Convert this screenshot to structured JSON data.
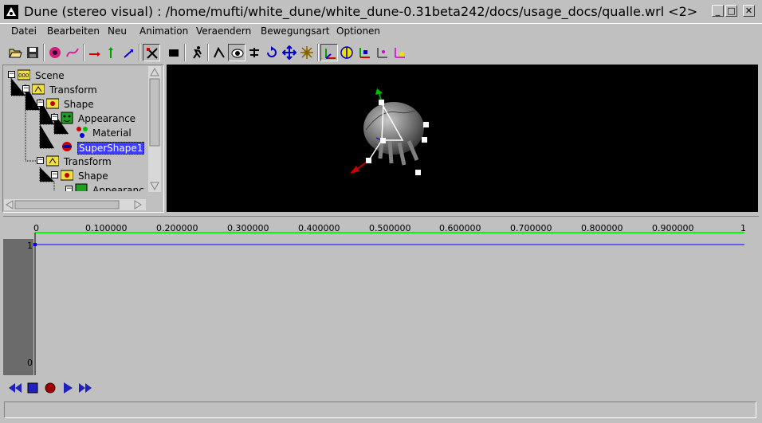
{
  "window": {
    "title": "Dune (stereo visual) : /home/mufti/white_dune/white_dune-0.31beta242/docs/usage_docs/qualle.wrl <2>",
    "buttons": {
      "minimize": "_",
      "maximize": "□",
      "close": "✕"
    }
  },
  "menu": [
    "Datei",
    "Bearbeiten",
    "Neu",
    "Animation",
    "Veraendern",
    "Bewegungsart",
    "Optionen"
  ],
  "toolbar": {
    "icons": [
      "open-icon",
      "save-icon",
      "colorcircle-icon",
      "curve-icon",
      "x-arrow-icon",
      "y-arrow-icon",
      "z-arrow-icon",
      "route-icon",
      "camera-icon",
      "run-icon",
      "walk-icon",
      "examine-icon",
      "fly-icon",
      "rotate-icon",
      "move-icon",
      "scale-icon",
      "axes-icon",
      "center-icon",
      "hanim-icon",
      "axes2-icon",
      "axes3-icon"
    ]
  },
  "scene_tree": {
    "nodes": [
      {
        "label": "Scene",
        "depth": 0,
        "icon": "scene-icon"
      },
      {
        "label": "Transform",
        "depth": 1,
        "icon": "transform-icon"
      },
      {
        "label": "Shape",
        "depth": 2,
        "icon": "shape-icon"
      },
      {
        "label": "Appearance",
        "depth": 3,
        "icon": "appearance-icon"
      },
      {
        "label": "Material",
        "depth": 4,
        "icon": "material-icon"
      },
      {
        "label": "SuperShape1",
        "depth": 3,
        "icon": "supershape-icon",
        "selected": true
      },
      {
        "label": "Transform",
        "depth": 2,
        "icon": "transform-icon"
      },
      {
        "label": "Shape",
        "depth": 3,
        "icon": "shape-icon"
      },
      {
        "label": "Appearanc",
        "depth": 4,
        "icon": "appearance-icon"
      }
    ]
  },
  "timeline": {
    "ticks": [
      "0",
      "0.100000",
      "0.200000",
      "0.300000",
      "0.400000",
      "0.500000",
      "0.600000",
      "0.700000",
      "0.800000",
      "0.900000",
      "1"
    ],
    "y_max": "1",
    "y_min": "0",
    "colors": {
      "axis": "#00ff00",
      "curve": "#0000ff",
      "left_panel": "#6b6b6b"
    }
  },
  "playback": {
    "buttons": [
      "rewind-icon",
      "stop-icon",
      "record-icon",
      "play-icon",
      "fast-forward-icon"
    ]
  },
  "status": {
    "text": ""
  }
}
